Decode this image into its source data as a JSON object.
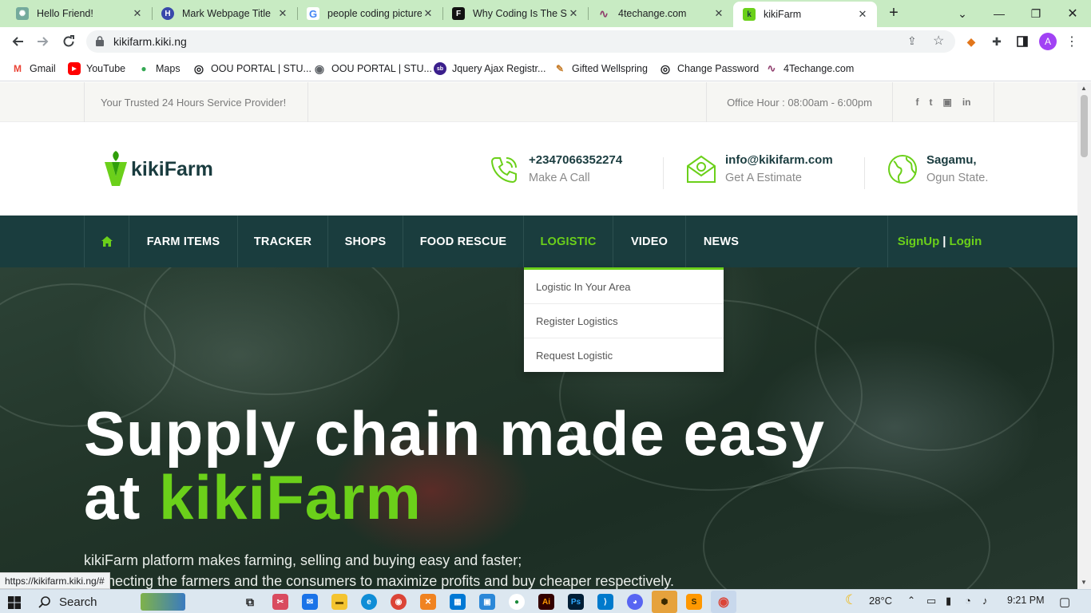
{
  "browser": {
    "tabs": [
      {
        "title": "Hello Friend!",
        "fav_color": "#74aa9c",
        "fav_glyph": "✺"
      },
      {
        "title": "Mark Webpage Title",
        "fav_color": "#3949ab",
        "fav_glyph": "H"
      },
      {
        "title": "people coding picture",
        "fav_color": "#4285f4",
        "fav_glyph": "G"
      },
      {
        "title": "Why Coding Is The Sc",
        "fav_color": "#111111",
        "fav_glyph": "F"
      },
      {
        "title": "4techange.com",
        "fav_color": "#8e3b6b",
        "fav_glyph": "∿"
      },
      {
        "title": "kikiFarm",
        "fav_color": "#6bd01a",
        "fav_glyph": "k"
      }
    ],
    "close_glyph": "✕",
    "new_tab_glyph": "+",
    "url": "kikifarm.kiki.ng",
    "profile_initial": "A",
    "status_url": "https://kikifarm.kiki.ng/#"
  },
  "bookmarks": [
    {
      "label": "Gmail",
      "color": "#ea4335",
      "glyph": "M"
    },
    {
      "label": "YouTube",
      "color": "#ff0000",
      "glyph": "▶"
    },
    {
      "label": "Maps",
      "color": "#34a853",
      "glyph": "●"
    },
    {
      "label": "OOU PORTAL | STU...",
      "color": "#202124",
      "glyph": "◎"
    },
    {
      "label": "OOU PORTAL | STU...",
      "color": "#5f6368",
      "glyph": "◉"
    },
    {
      "label": "Jquery Ajax Registr...",
      "color": "#3b1f8c",
      "glyph": "sb"
    },
    {
      "label": "Gifted Wellspring",
      "color": "#c77d2a",
      "glyph": "✎"
    },
    {
      "label": "Change Password",
      "color": "#202124",
      "glyph": "◎"
    },
    {
      "label": "4Techange.com",
      "color": "#8e3b6b",
      "glyph": "∿"
    }
  ],
  "site": {
    "topbar": {
      "tagline": "Your Trusted 24 Hours Service Provider!",
      "office_hours": "Office Hour : 08:00am - 6:00pm",
      "social": [
        "f",
        "t",
        "▣",
        "in"
      ]
    },
    "brand": "kikiFarm",
    "contacts": [
      {
        "main": "+2347066352274",
        "sub": "Make A Call",
        "icon": "phone-icon"
      },
      {
        "main": "info@kikifarm.com",
        "sub": "Get A Estimate",
        "icon": "mail-icon"
      },
      {
        "main": "Sagamu,",
        "sub": "Ogun State.",
        "icon": "globe-icon"
      }
    ],
    "nav": [
      "FARM ITEMS",
      "TRACKER",
      "SHOPS",
      "FOOD RESCUE",
      "LOGISTIC",
      "VIDEO",
      "NEWS"
    ],
    "nav_active": "LOGISTIC",
    "auth": {
      "signup": "SignUp",
      "separator": "|",
      "login": "Login"
    },
    "dropdown": [
      "Logistic In Your Area",
      "Register Logistics",
      "Request Logistic"
    ],
    "hero": {
      "line1": "Supply chain made easy",
      "line2_prefix": "at ",
      "line2_accent": "kikiFarm",
      "para1": "kikiFarm platform makes farming, selling and buying easy and faster;",
      "para2": "connecting the farmers and the consumers to maximize profits and buy cheaper respectively."
    },
    "colors": {
      "accent": "#6bd01a",
      "nav_bg": "#1a3d3e",
      "brand_text": "#1a3c3f"
    }
  },
  "taskbar": {
    "search_label": "Search",
    "temperature": "28°C",
    "time": "9:21 PM"
  }
}
